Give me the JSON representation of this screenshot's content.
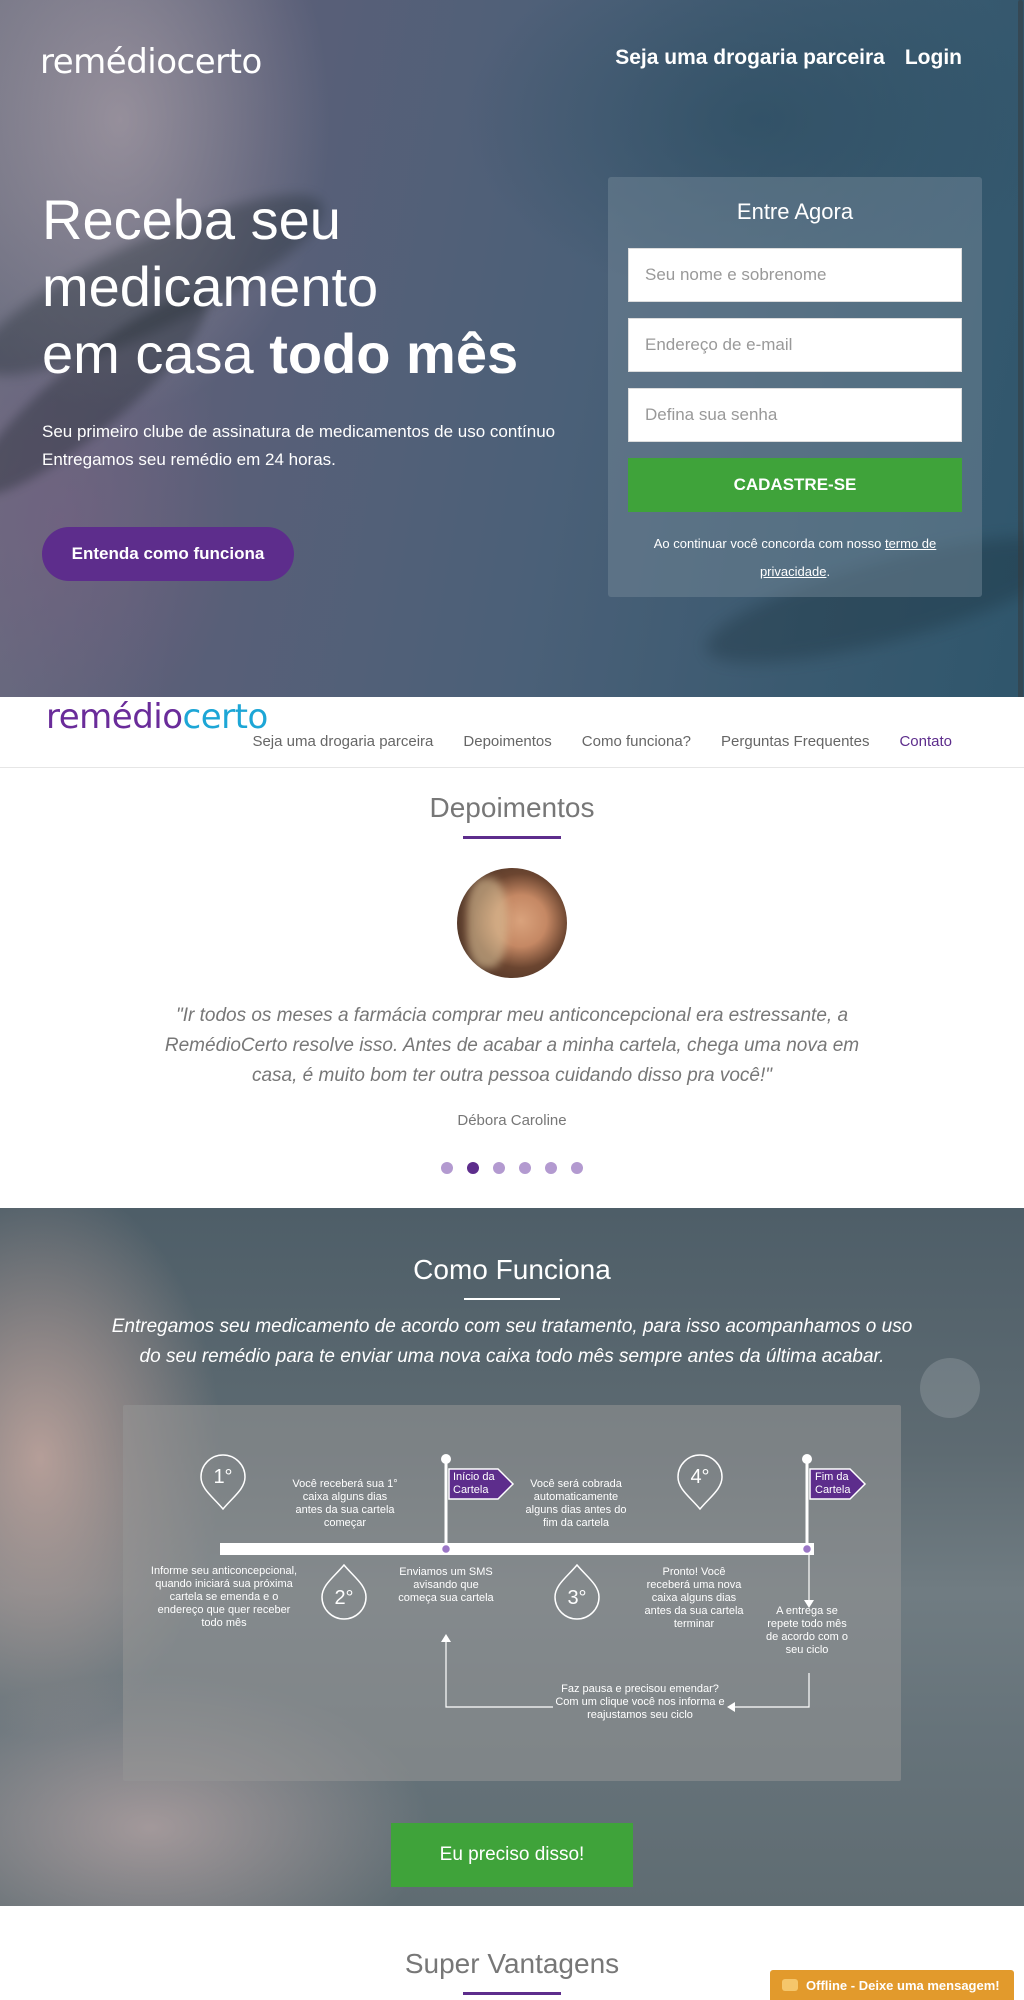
{
  "brand": {
    "logo_hero": "remédiocerto",
    "logo_nav_part1": "remédio",
    "logo_nav_part2": "certo",
    "accent_purple": "#5d2d8c",
    "accent_green": "#3fa33a",
    "accent_blue": "#1da6d6"
  },
  "topnav": {
    "partner": "Seja uma drogaria parceira",
    "login": "Login"
  },
  "hero": {
    "title_line1": "Receba seu",
    "title_line2": "medicamento",
    "title_line3_plain": "em casa ",
    "title_line3_bold": "todo mês",
    "sub_line1": "Seu primeiro clube de assinatura de medicamentos de uso contínuo",
    "sub_line2": "Entregamos seu remédio em 24 horas.",
    "cta": "Entenda como funciona"
  },
  "signup": {
    "title": "Entre Agora",
    "name_placeholder": "Seu nome e sobrenome",
    "email_placeholder": "Endereço de e-mail",
    "password_placeholder": "Defina sua senha",
    "submit": "CADASTRE-SE",
    "terms_prefix": "Ao continuar você concorda com nosso ",
    "terms_link": "termo de privacidade",
    "terms_suffix": "."
  },
  "navbar": {
    "items": [
      {
        "label": "Seja uma drogaria parceira"
      },
      {
        "label": "Depoimentos"
      },
      {
        "label": "Como funciona?"
      },
      {
        "label": "Perguntas Frequentes"
      },
      {
        "label": "Contato"
      }
    ]
  },
  "testimonials": {
    "title": "Depoimentos",
    "quote": "\"Ir todos os meses a farmácia comprar meu anticoncepcional era estressante, a RemédioCerto resolve isso. Antes de acabar a minha cartela, chega uma nova em casa, é muito bom ter outra pessoa cuidando disso pra você!\"",
    "author": "Débora Caroline",
    "dot_count": 6,
    "active_dot": 2
  },
  "how": {
    "title": "Como Funciona",
    "lead": "Entregamos seu medicamento de acordo com seu tratamento, para isso acompanhamos o uso do seu remédio para te enviar uma nova caixa todo mês sempre antes da última acabar.",
    "step1_num": "1°",
    "step2_num": "2°",
    "step3_num": "3°",
    "step4_num": "4°",
    "flag_start": "Início da Cartela",
    "flag_end": "Fim da Cartela",
    "t_step1": "Informe seu anticoncepcional, quando iniciará sua próxima cartela se emenda e o endereço que quer receber todo mês",
    "t_box": "Você receberá sua 1° caixa  alguns dias antes da sua cartela começar",
    "t_sms": "Enviamos um SMS avisando que começa sua cartela",
    "t_charge": "Você será cobrada automaticamente alguns dias antes do fim da cartela",
    "t_ready": "Pronto! Você receberá uma nova caixa alguns dias antes da sua cartela terminar",
    "t_repeat": "A entrega se repete todo mês de acordo com o seu ciclo",
    "t_pause": "Faz pausa e precisou emendar? Com um clique você nos informa e reajustamos seu ciclo",
    "cta": "Eu preciso disso!"
  },
  "advantages": {
    "title": "Super Vantagens"
  },
  "chat": {
    "label": "Offline - Deixe uma mensagem!"
  }
}
